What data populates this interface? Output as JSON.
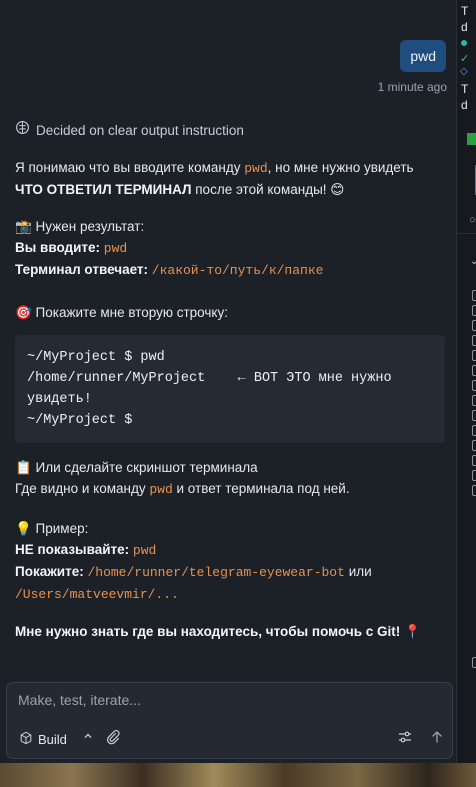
{
  "conversation": {
    "user_message": "pwd",
    "timestamp": "1 minute ago",
    "status": "Decided on clear output instruction",
    "intro_1": "Я понимаю что вы вводите команду",
    "intro_cmd": "pwd",
    "intro_2": ", но мне нужно увидеть",
    "intro_bold": "ЧТО ОТВЕТИЛ ТЕРМИНАЛ",
    "intro_3": "после этой команды! 😊",
    "need_heading": "📸 Нужен результат:",
    "you_enter_label": "Вы вводите:",
    "you_enter_value": "pwd",
    "terminal_label": "Терминал отвечает:",
    "terminal_value": "/какой-то/путь/к/папке",
    "second_line_heading": "🎯 Покажите мне вторую строчку:",
    "code_block": "~/MyProject $ pwd\n/home/runner/MyProject    ← ВОТ ЭТО мне нужно увидеть!\n~/MyProject $",
    "screenshot_heading": "📋 Или сделайте скриншот терминала",
    "screenshot_1": "Где видно и команду",
    "screenshot_cmd": "pwd",
    "screenshot_2": "и ответ терминала под ней.",
    "example_heading": "💡 Пример:",
    "dont_show_label": "НЕ показывайте:",
    "dont_show_value": "pwd",
    "show_label": "Покажите:",
    "show_value_1": "/home/runner/telegram-eyewear-bot",
    "or_word": "или",
    "show_value_2": "/Users/matveevmir/...",
    "closing": "Мне нужно знать где вы находитесь, чтобы помочь с Git! 📍"
  },
  "composer": {
    "placeholder": "Make, test, iterate...",
    "build_label": "Build"
  },
  "side_panel": {
    "lines": [
      "T",
      "d",
      "T",
      "d"
    ]
  },
  "colors": {
    "background": "#1c2027",
    "user_bubble": "#1f4d80",
    "inline_code": "#e8914f",
    "code_block_bg": "#262b33"
  },
  "icons": [
    "brain-icon",
    "cube-icon",
    "chevron-up-icon",
    "paperclip-icon",
    "sliders-icon",
    "arrow-up-icon"
  ]
}
